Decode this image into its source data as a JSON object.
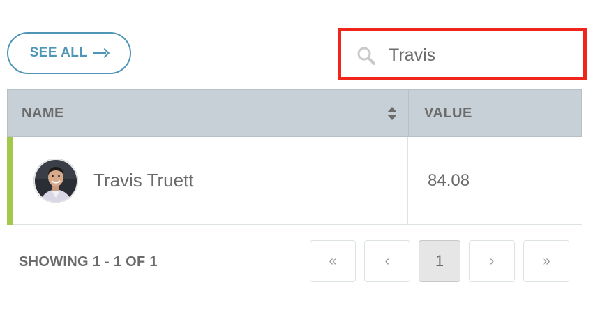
{
  "toolbar": {
    "see_all_label": "SEE ALL",
    "arrow_icon": "arrow-right-icon"
  },
  "search": {
    "value": "Travis",
    "icon": "search-icon",
    "highlight_color": "#f0261d"
  },
  "table": {
    "columns": [
      {
        "label": "NAME",
        "sortable": true
      },
      {
        "label": "VALUE",
        "sortable": false
      }
    ],
    "rows": [
      {
        "name": "Travis Truett",
        "value": "84.08",
        "avatar": "avatar-photo",
        "accent_color": "#a3c84a"
      }
    ]
  },
  "footer": {
    "showing_text": "SHOWING 1 - 1 OF 1"
  },
  "pagination": {
    "first": "«",
    "prev": "‹",
    "current": "1",
    "next": "›",
    "last": "»"
  },
  "colors": {
    "accent": "#4f95b6",
    "header_bg": "#c6d0d6",
    "text": "#6b6b6b"
  }
}
